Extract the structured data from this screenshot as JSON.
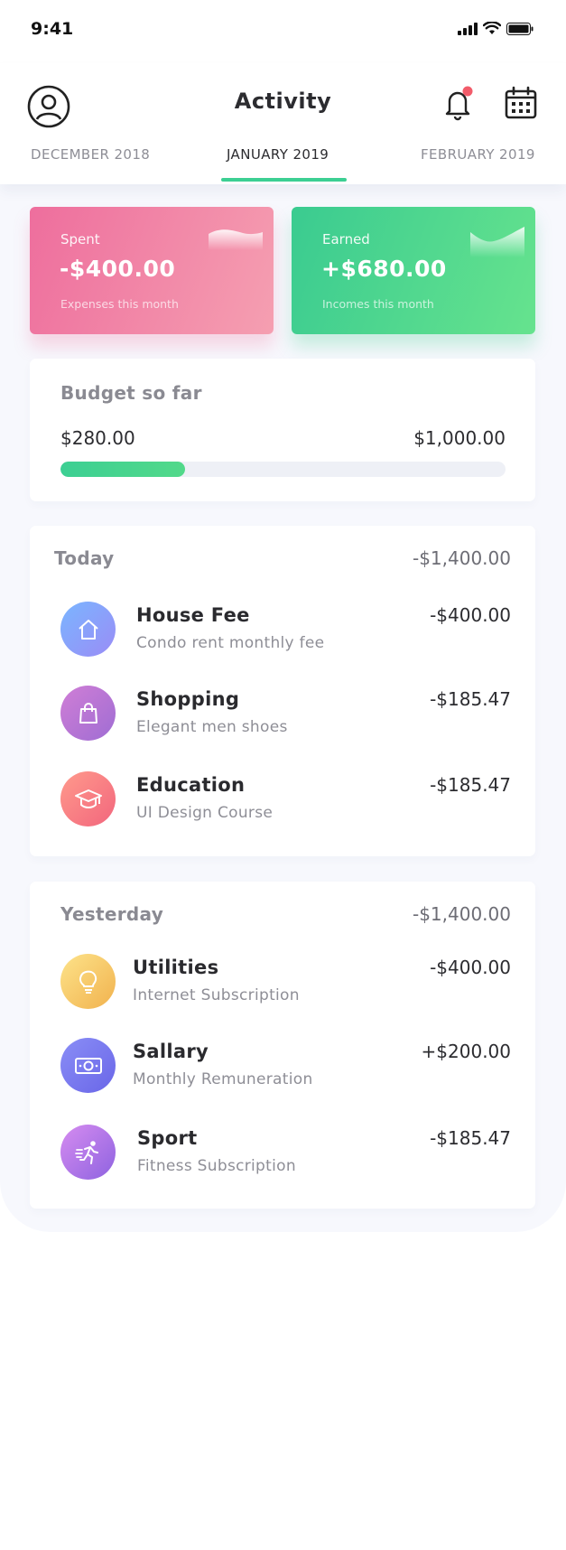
{
  "status_bar": {
    "time": "9:41"
  },
  "header": {
    "title": "Activity",
    "months": [
      "DECEMBER 2018",
      "JANUARY 2019",
      "FEBRUARY 2019"
    ],
    "active_month": "JANUARY 2019"
  },
  "summary": {
    "spent": {
      "label": "Spent",
      "amount": "-$400.00",
      "caption": "Expenses this month"
    },
    "earned": {
      "label": "Earned",
      "amount": "+$680.00",
      "caption": "Incomes this month"
    }
  },
  "budget": {
    "title": "Budget so far",
    "spent": "$280.00",
    "total": "$1,000.00",
    "progress_fraction": 0.28
  },
  "sections": [
    {
      "title": "Today",
      "total": "-$1,400.00",
      "items": [
        {
          "title": "House Fee",
          "subtitle": "Condo rent monthly fee",
          "amount": "-$400.00",
          "icon": "house-icon"
        },
        {
          "title": "Shopping",
          "subtitle": "Elegant men shoes",
          "amount": "-$185.47",
          "icon": "shopping-bag-icon"
        },
        {
          "title": "Education",
          "subtitle": "UI Design Course",
          "amount": "-$185.47",
          "icon": "graduation-cap-icon"
        }
      ]
    },
    {
      "title": "Yesterday",
      "total": "-$1,400.00",
      "items": [
        {
          "title": "Utilities",
          "subtitle": "Internet Subscription",
          "amount": "-$400.00",
          "icon": "lightbulb-icon"
        },
        {
          "title": "Sallary",
          "subtitle": "Monthly Remuneration",
          "amount": "+$200.00",
          "icon": "money-bill-icon"
        },
        {
          "title": "Sport",
          "subtitle": "Fitness Subscription",
          "amount": "-$185.47",
          "icon": "running-person-icon"
        }
      ]
    }
  ],
  "colors": {
    "accent_green": "#3ccf93",
    "spent_pink": "#ee6e9d",
    "earned_green": "#3acb90",
    "notification_dot": "#f25c6a"
  }
}
